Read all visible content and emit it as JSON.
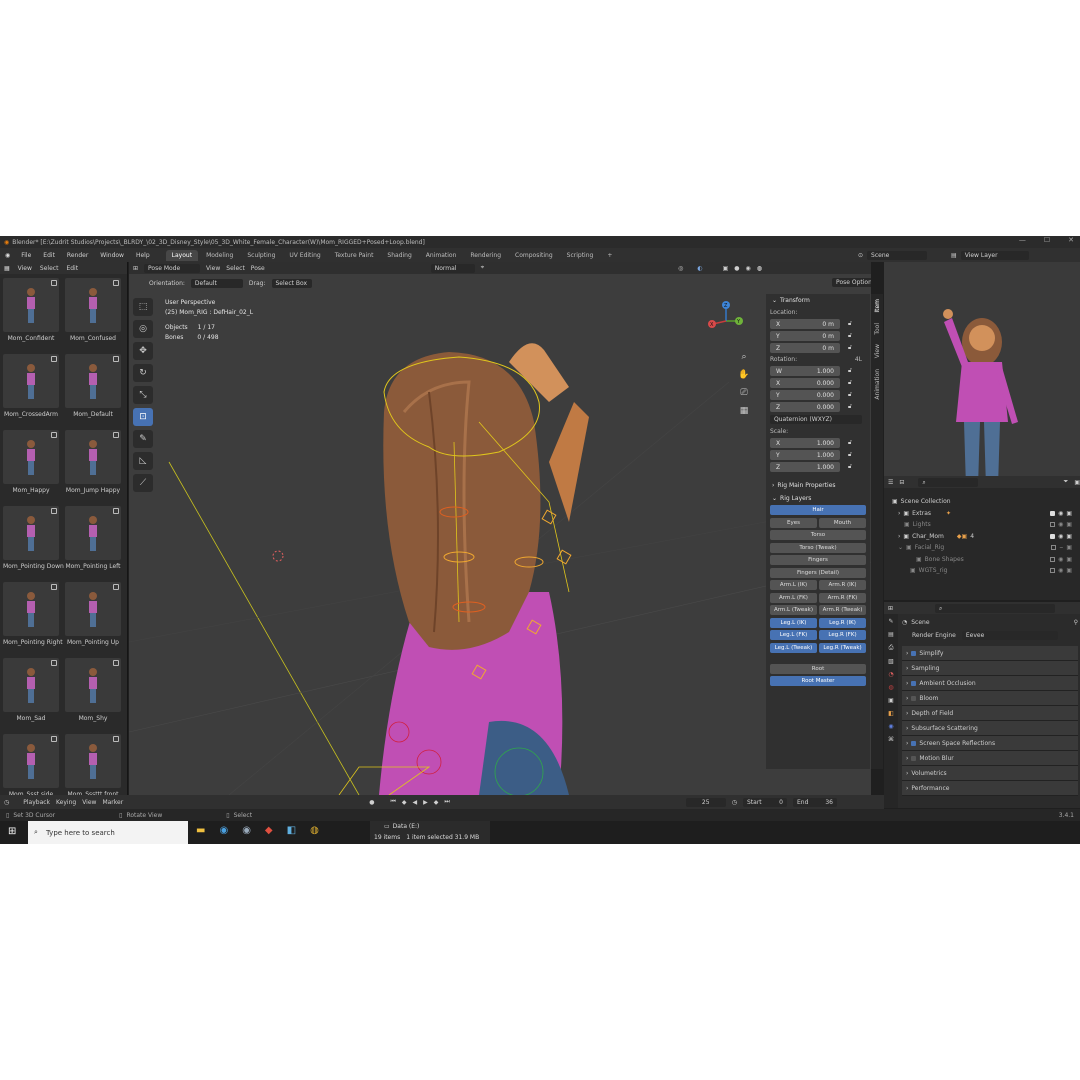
{
  "title_bar": {
    "text": "Blender* [E:\\Zudrit Studios\\Projects\\_BLRDY_\\02_3D_Disney_Style\\05_3D_White_Female_Character(W)\\Mom_RIGGED+Posed+Loop.blend]",
    "minimize": "—",
    "maximize": "☐",
    "close": "✕"
  },
  "menu": [
    "File",
    "Edit",
    "Render",
    "Window",
    "Help"
  ],
  "workspaces": [
    "Layout",
    "Modeling",
    "Sculpting",
    "UV Editing",
    "Texture Paint",
    "Shading",
    "Animation",
    "Rendering",
    "Compositing",
    "Scripting"
  ],
  "scene": {
    "label": "Scene",
    "view_layer": "View Layer"
  },
  "assets": {
    "menu": [
      "View",
      "Select",
      "Edit"
    ],
    "items": [
      "Mom_Confident",
      "Mom_Confused",
      "Mom_CrossedArm",
      "Mom_Default",
      "Mom_Happy",
      "Mom_Jump Happy",
      "Mom_Pointing Down",
      "Mom_Pointing Left",
      "Mom_Pointing Right",
      "Mom_Pointing Up",
      "Mom_Sad",
      "Mom_Shy",
      "Mom_Ssst side",
      "Mom_Sssttt front",
      "",
      ""
    ]
  },
  "viewport": {
    "mode": "Pose Mode",
    "menu": [
      "View",
      "Select",
      "Pose"
    ],
    "orientation_label": "Orientation:",
    "orientation": "Default",
    "drag_label": "Drag:",
    "drag": "Select Box",
    "pivot": "Normal",
    "pose_options": "Pose Options",
    "info": {
      "view": "User Perspective",
      "object": "(25) Mom_RIG : DefHair_02_L",
      "objects_label": "Objects",
      "objects_value": "1 / 17",
      "bones_label": "Bones",
      "bones_value": "0 / 498"
    },
    "gizmo": {
      "x": "X",
      "y": "Y",
      "z": "Z"
    }
  },
  "npanel": {
    "transform": "Transform",
    "location": "Location:",
    "loc": [
      {
        "axis": "X",
        "val": "0 m"
      },
      {
        "axis": "Y",
        "val": "0 m"
      },
      {
        "axis": "Z",
        "val": "0 m"
      }
    ],
    "rotation": "Rotation:",
    "rot_mode_short": "4L",
    "rot": [
      {
        "axis": "W",
        "val": "1.000"
      },
      {
        "axis": "X",
        "val": "0.000"
      },
      {
        "axis": "Y",
        "val": "0.000"
      },
      {
        "axis": "Z",
        "val": "0.000"
      }
    ],
    "rot_mode": "Quaternion (WXYZ)",
    "scale": "Scale:",
    "scl": [
      {
        "axis": "X",
        "val": "1.000"
      },
      {
        "axis": "Y",
        "val": "1.000"
      },
      {
        "axis": "Z",
        "val": "1.000"
      }
    ],
    "rig_main": "Rig Main Properties",
    "rig_layers": "Rig Layers",
    "layers": {
      "hair": "Hair",
      "eyes": "Eyes",
      "mouth": "Mouth",
      "torso": "Torso",
      "torso_tweak": "Torso (Tweak)",
      "fingers": "Fingers",
      "fingers_detail": "Fingers (Detail)",
      "arm_l_ik": "Arm.L (IK)",
      "arm_r_ik": "Arm.R (IK)",
      "arm_l_fk": "Arm.L (FK)",
      "arm_r_fk": "Arm.R (FK)",
      "arm_l_tweak": "Arm.L (Tweak)",
      "arm_r_tweak": "Arm.R (Tweak)",
      "leg_l_ik": "Leg.L (IK)",
      "leg_r_ik": "Leg.R (IK)",
      "leg_l_fk": "Leg.L (FK)",
      "leg_r_fk": "Leg.R (FK)",
      "leg_l_tweak": "Leg.L (Tweak)",
      "leg_r_tweak": "Leg.R (Tweak)",
      "root": "Root",
      "root_master": "Root Master"
    },
    "tabs": [
      "Item",
      "Tool",
      "View",
      "Animation"
    ]
  },
  "outliner": {
    "root": "Scene Collection",
    "items": [
      "Extras",
      "Lights",
      "Char_Mom",
      "Facial_Rig",
      "Bone Shapes",
      "WGTS_rig"
    ],
    "char_badge": "4"
  },
  "properties": {
    "scene": "Scene",
    "render_engine_label": "Render Engine",
    "render_engine": "Eevee",
    "panels": [
      "Simplify",
      "Sampling",
      "Ambient Occlusion",
      "Bloom",
      "Depth of Field",
      "Subsurface Scattering",
      "Screen Space Reflections",
      "Motion Blur",
      "Volumetrics",
      "Performance"
    ]
  },
  "timeline": {
    "menu": [
      "Playback",
      "Keying",
      "View",
      "Marker"
    ],
    "frame": "25",
    "start_label": "Start",
    "start": "0",
    "end_label": "End",
    "end": "36"
  },
  "statusbar": {
    "left": "Set 3D Cursor",
    "mid": "Rotate View",
    "right": "Select",
    "version": "3.4.1"
  },
  "taskbar": {
    "search": "Type here to search",
    "drive": "Data (E:)",
    "items": "19 items",
    "selected": "1 item selected  31.9 MB"
  }
}
